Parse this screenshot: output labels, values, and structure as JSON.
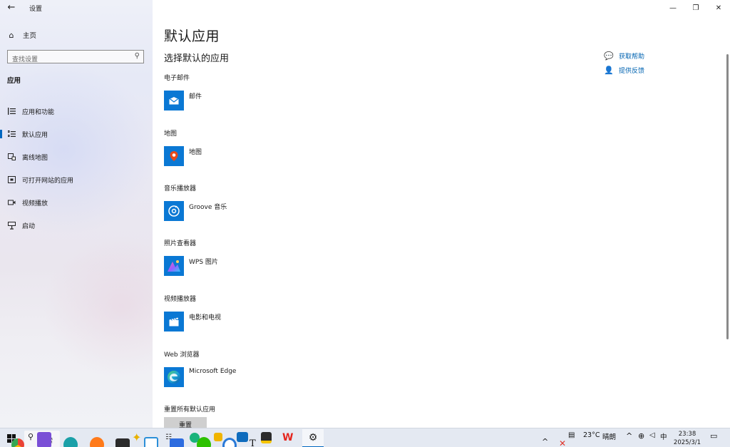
{
  "window": {
    "app_title": "设置",
    "minimize_glyph": "—",
    "restore_glyph": "❐",
    "close_glyph": "✕"
  },
  "sidebar": {
    "home_label": "主页",
    "search_placeholder": "查找设置",
    "section_label": "应用",
    "items": [
      {
        "label": "应用和功能",
        "icon": "list-icon"
      },
      {
        "label": "默认应用",
        "icon": "default-apps-icon",
        "active": true
      },
      {
        "label": "离线地图",
        "icon": "map-icon"
      },
      {
        "label": "可打开网站的应用",
        "icon": "web-apps-icon"
      },
      {
        "label": "视频播放",
        "icon": "video-icon"
      },
      {
        "label": "启动",
        "icon": "startup-icon"
      }
    ]
  },
  "main": {
    "title": "默认应用",
    "subtitle": "选择默认的应用",
    "groups": [
      {
        "label": "电子邮件",
        "app": "邮件",
        "icon": "mail-icon"
      },
      {
        "label": "地图",
        "app": "地图",
        "icon": "maps-icon"
      },
      {
        "label": "音乐播放器",
        "app": "Groove 音乐",
        "icon": "groove-music-icon"
      },
      {
        "label": "照片查看器",
        "app": "WPS 图片",
        "icon": "wps-pictures-icon"
      },
      {
        "label": "视频播放器",
        "app": "电影和电视",
        "icon": "movies-tv-icon"
      },
      {
        "label": "Web 浏览器",
        "app": "Microsoft Edge",
        "icon": "edge-icon"
      }
    ],
    "reset_label": "重置所有默认应用",
    "reset_button": "重置",
    "help": {
      "get_help": "获取帮助",
      "feedback": "提供反馈"
    }
  },
  "taskbar": {
    "search_label": "搜索",
    "weather": "23°C",
    "weather_desc": "晴朗",
    "ime": "中",
    "time": "23:38",
    "date": "2025/3/1",
    "accent": "#0067c0"
  }
}
